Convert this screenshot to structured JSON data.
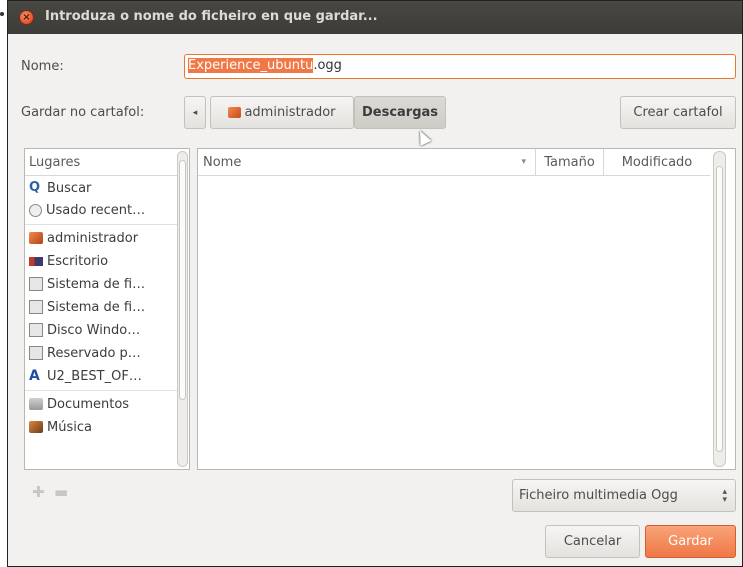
{
  "dialog": {
    "title": "Introduza o nome do ficheiro en que gardar..."
  },
  "name_field": {
    "label": "Nome:",
    "selected_part": "Experience_ubuntu",
    "unselected_part": ".ogg"
  },
  "folder_row": {
    "label": "Gardar no cartafol:",
    "path_buttons": [
      "administrador",
      "Descargas"
    ],
    "active_path": "Descargas",
    "create_folder_label": "Crear cartafol"
  },
  "places": {
    "header": "Lugares",
    "items": [
      {
        "label": "Buscar",
        "icon": "search-icon"
      },
      {
        "label": "Usado recent…",
        "icon": "clock-icon"
      },
      {
        "label": "administrador",
        "icon": "home-folder-icon"
      },
      {
        "label": "Escritorio",
        "icon": "desktop-icon"
      },
      {
        "label": "Sistema de fi…",
        "icon": "drive-icon"
      },
      {
        "label": "Sistema de fi…",
        "icon": "drive-icon"
      },
      {
        "label": "Disco Windo…",
        "icon": "drive-icon"
      },
      {
        "label": "Reservado p…",
        "icon": "drive-icon"
      },
      {
        "label": "U2_BEST_OF…",
        "icon": "cdrom-icon"
      },
      {
        "label": "Documentos",
        "icon": "documents-folder-icon"
      },
      {
        "label": "Música",
        "icon": "music-folder-icon"
      }
    ]
  },
  "files": {
    "columns": [
      "Nome",
      "Tamaño",
      "Modificado"
    ],
    "sort_indicator": "▾"
  },
  "filter": {
    "selected": "Ficheiro multimedia Ogg"
  },
  "buttons": {
    "cancel": "Cancelar",
    "save": "Gardar"
  },
  "colors": {
    "accent": "#f07746",
    "titlebar": "#3c3b37"
  }
}
